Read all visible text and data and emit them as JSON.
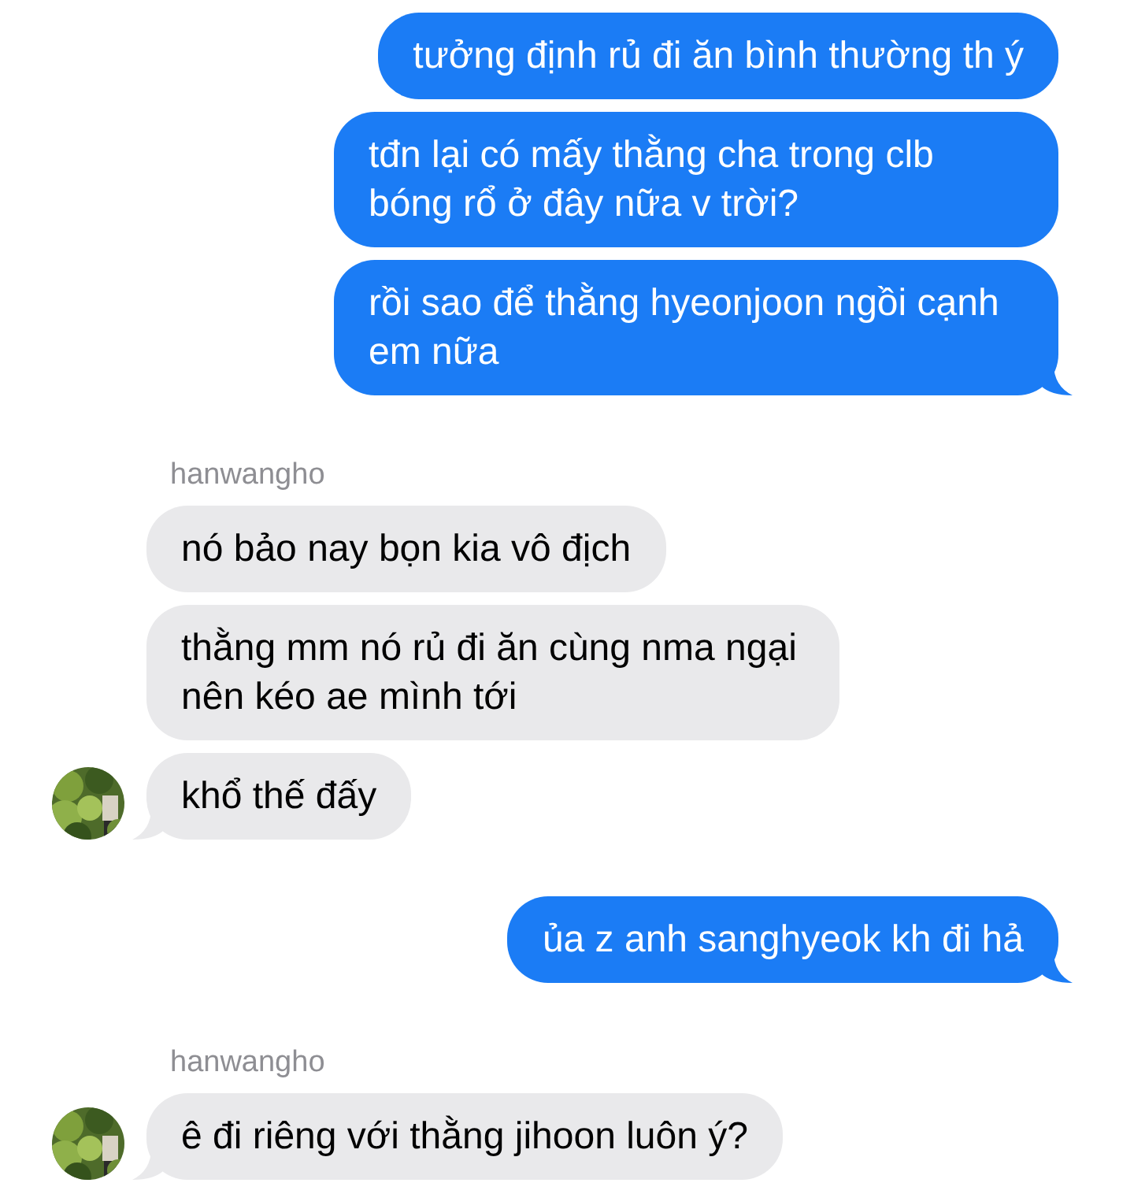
{
  "messages": [
    {
      "kind": "sent",
      "text": "tưởng định rủ đi ăn bình thường th ý",
      "tail": false
    },
    {
      "kind": "sent",
      "text": "tđn lại có mấy thằng cha trong clb bóng rổ ở đây nữa v trời?",
      "tail": false
    },
    {
      "kind": "sent",
      "text": "rồi sao để thằng hyeonjoon ngồi cạnh em nữa",
      "tail": true
    },
    {
      "kind": "sender",
      "text": "hanwangho"
    },
    {
      "kind": "received",
      "text": "nó bảo nay bọn kia vô địch",
      "tail": false,
      "avatar": false
    },
    {
      "kind": "received",
      "text": "thằng mm nó rủ đi ăn cùng nma ngại nên kéo ae mình tới",
      "tail": false,
      "avatar": false
    },
    {
      "kind": "received",
      "text": "khổ thế đấy",
      "tail": true,
      "avatar": true
    },
    {
      "kind": "sent",
      "text": "ủa z anh sanghyeok kh đi hả",
      "tail": true
    },
    {
      "kind": "sender",
      "text": "hanwangho"
    },
    {
      "kind": "received",
      "text": "ê đi riêng với thằng jihoon luôn ý?",
      "tail": true,
      "avatar": true
    }
  ]
}
